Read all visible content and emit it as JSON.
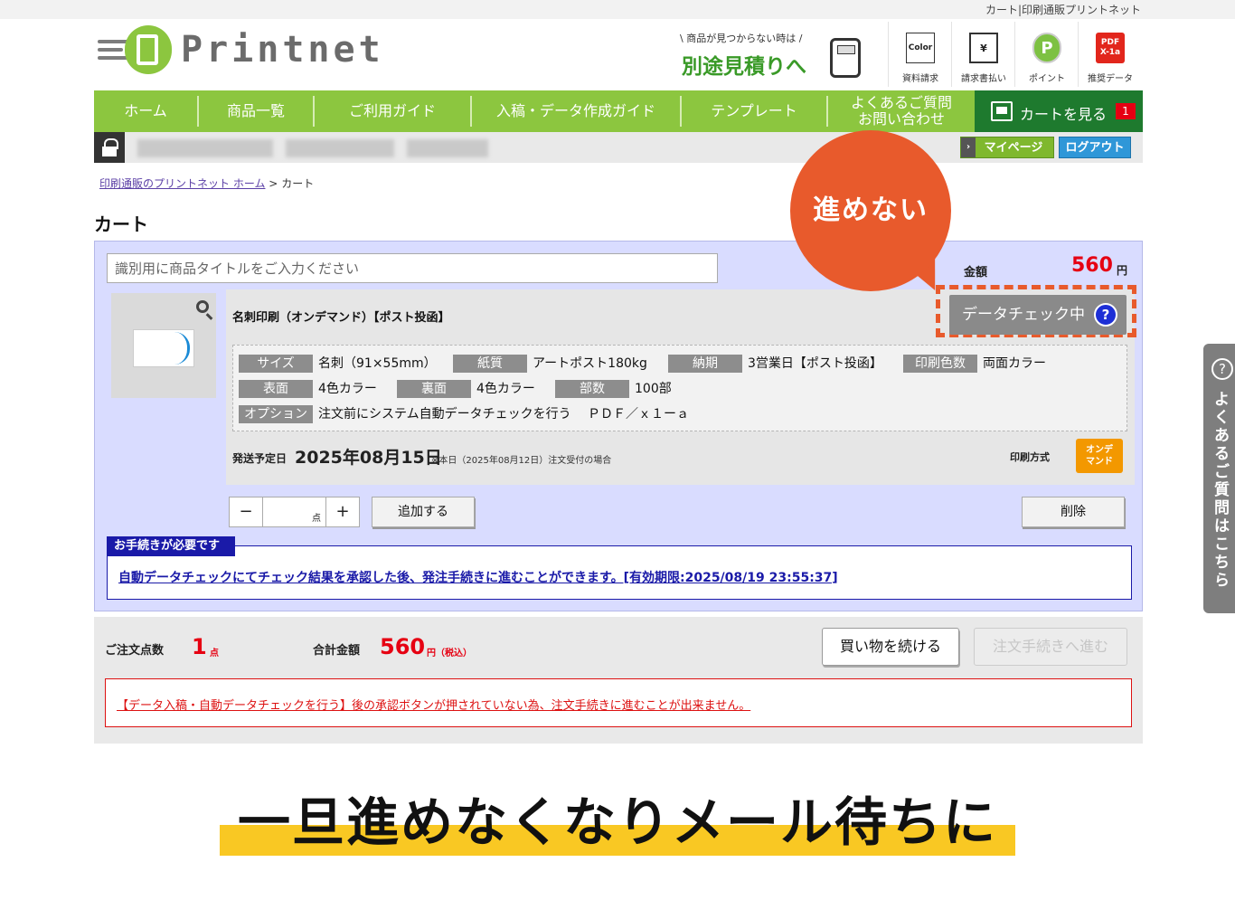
{
  "topbar": {
    "site_title": "カート|印刷通販プリントネット"
  },
  "logo": {
    "text": "Printnet"
  },
  "estimate": {
    "small": "\\ 商品が見つからない時は /",
    "big": "別途見積りへ"
  },
  "quick_links": [
    {
      "label": "資料請求",
      "icon": "document-request-icon",
      "icon_text": "Color"
    },
    {
      "label": "請求書払い",
      "icon": "invoice-icon",
      "icon_text": "¥"
    },
    {
      "label": "ポイント",
      "icon": "point-icon",
      "icon_text": "P"
    },
    {
      "label": "推奨データ",
      "icon": "pdf-icon",
      "icon_text": "PDF X-1a"
    }
  ],
  "nav": {
    "items": [
      "ホーム",
      "商品一覧",
      "ご利用ガイド",
      "入稿・データ作成ガイド",
      "テンプレート"
    ],
    "faq_line1": "よくあるご質問",
    "faq_line2": "お問い合わせ",
    "cart_label": "カートを見る",
    "cart_count": "1"
  },
  "userbar": {
    "mypage": "マイページ",
    "logout": "ログアウト"
  },
  "breadcrumb": {
    "home": "印刷通販のプリントネット ホーム",
    "separator": ">",
    "current": "カート"
  },
  "page_title": "カート",
  "bubble": "進めない",
  "cart_item": {
    "title_placeholder": "識別用に商品タイトルをご入力ください",
    "amount_label": "金額",
    "amount_value": "560",
    "amount_unit": "円",
    "product_name": "名刺印刷（オンデマンド）【ポスト投函】",
    "status_button": "データチェック中",
    "status_help": "?",
    "specs": [
      {
        "key": "サイズ",
        "value": "名刺（91×55mm）"
      },
      {
        "key": "紙質",
        "value": "アートポスト180kg"
      },
      {
        "key": "納期",
        "value": "3営業日【ポスト投函】"
      },
      {
        "key": "印刷色数",
        "value": "両面カラー"
      },
      {
        "key": "表面",
        "value": "4色カラー"
      },
      {
        "key": "裏面",
        "value": "4色カラー"
      },
      {
        "key": "部数",
        "value": "100部"
      },
      {
        "key": "オプション",
        "value": "注文前にシステム自動データチェックを行う　 ＰＤＦ／ｘ１ーａ"
      }
    ],
    "ship_label": "発送予定日",
    "ship_date": "2025年08月15日",
    "ship_note": "※本日（2025年08月12日）注文受付の場合",
    "print_method_label": "印刷方式",
    "print_method_badge_1": "オンデ",
    "print_method_badge_2": "マンド",
    "qty_minus": "−",
    "qty_plus": "+",
    "qty_unit": "点",
    "add_button": "追加する",
    "delete_button": "削除",
    "notice_tag": "お手続きが必要です",
    "notice_link": "自動データチェックにてチェック結果を承認した後、発注手続きに進むことができます。[有効期限:2025/08/19 23:55:37]"
  },
  "summary": {
    "count_label": "ご注文点数",
    "count_value": "1",
    "count_unit": "点",
    "total_label": "合計金額",
    "total_value": "560",
    "total_unit": "円（税込）",
    "continue_button": "買い物を続ける",
    "proceed_button": "注文手続きへ進む",
    "error": "【データ入稿・自動データチェックを行う】後の承認ボタンが押されていない為、注文手続きに進むことが出来ません。"
  },
  "side_tab": {
    "text": "よくあるご質問はこちら"
  },
  "headline": "一旦進めなくなりメール待ちに",
  "colors": {
    "brand_green": "#8cc63f",
    "accent_orange": "#e85a2c",
    "price_red": "#e60012",
    "highlight_yellow": "#f9c823"
  }
}
